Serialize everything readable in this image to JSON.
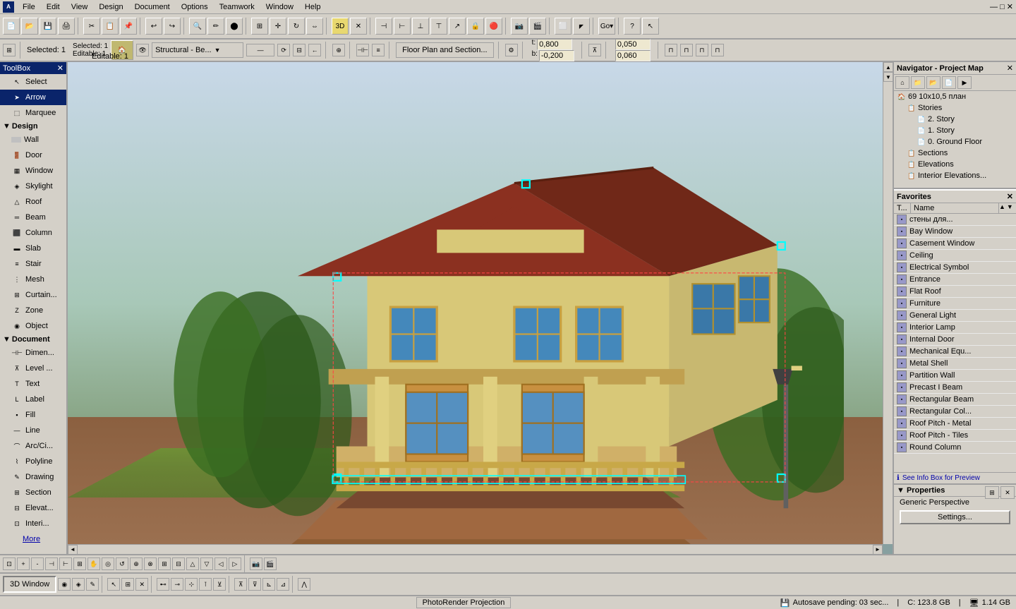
{
  "app": {
    "title": "ArchiCAD",
    "menu_items": [
      "File",
      "Edit",
      "View",
      "Design",
      "Document",
      "Options",
      "Teamwork",
      "Window",
      "Help"
    ]
  },
  "toolbar2": {
    "selected_label": "Selected: 1",
    "editable_label": "Editable: 1",
    "view_label": "Structural - Be...",
    "t_value": "0,800",
    "b_value": "-0,200",
    "coord_value": "0,050",
    "coord2_value": "0,060",
    "floor_plan_label": "Floor Plan and Section..."
  },
  "toolbox": {
    "title": "ToolBox",
    "select_label": "Select",
    "sections": [
      {
        "name": "Design",
        "items": [
          "Wall",
          "Door",
          "Window",
          "Skylight",
          "Roof",
          "Beam",
          "Column",
          "Slab",
          "Stair",
          "Mesh",
          "Curtain...",
          "Zone",
          "Object"
        ]
      },
      {
        "name": "Document",
        "items": [
          "Dimen...",
          "Level ...",
          "Text",
          "Label",
          "Fill",
          "Line",
          "Arc/Ci...",
          "Polyline",
          "Drawing",
          "Section",
          "Elevat...",
          "Interi..."
        ]
      }
    ],
    "more_label": "More",
    "arrow_label": "Arrow",
    "marquee_label": "Marquee"
  },
  "navigator": {
    "title": "Navigator - Project Map",
    "project_name": "69 10x10,5 план",
    "stories_label": "Stories",
    "story_2": "2. Story",
    "story_1": "1. Story",
    "story_0": "0. Ground Floor",
    "sections_label": "Sections",
    "elevations_label": "Elevations",
    "interior_label": "Interior Elevations..."
  },
  "favorites": {
    "title": "Favorites",
    "col_t": "T...",
    "col_name": "Name",
    "items": [
      {
        "name": "стены для..."
      },
      {
        "name": "Bay Window"
      },
      {
        "name": "Casement Window"
      },
      {
        "name": "Ceiling"
      },
      {
        "name": "Electrical Symbol"
      },
      {
        "name": "Entrance"
      },
      {
        "name": "Flat Roof"
      },
      {
        "name": "Furniture"
      },
      {
        "name": "General Light"
      },
      {
        "name": "Interior Lamp"
      },
      {
        "name": "Internal Door"
      },
      {
        "name": "Mechanical Equ..."
      },
      {
        "name": "Metal Shell"
      },
      {
        "name": "Partition Wall"
      },
      {
        "name": "Precast I Beam"
      },
      {
        "name": "Rectangular Beam"
      },
      {
        "name": "Rectangular Col..."
      },
      {
        "name": "Roof Pitch - Metal"
      },
      {
        "name": "Roof Pitch - Tiles"
      },
      {
        "name": "Round Column"
      }
    ],
    "see_info_label": "See Info Box for Preview"
  },
  "properties": {
    "title": "Properties",
    "item_label": "Generic Perspective",
    "settings_label": "Settings..."
  },
  "statusbar": {
    "center_label": "PhotoRender Projection",
    "autosave_label": "Autosave pending: 03 sec...",
    "disk_label": "C: 123.8 GB",
    "ram_label": "1.14 GB"
  },
  "bottom_bar": {
    "window_label": "3D Window"
  }
}
